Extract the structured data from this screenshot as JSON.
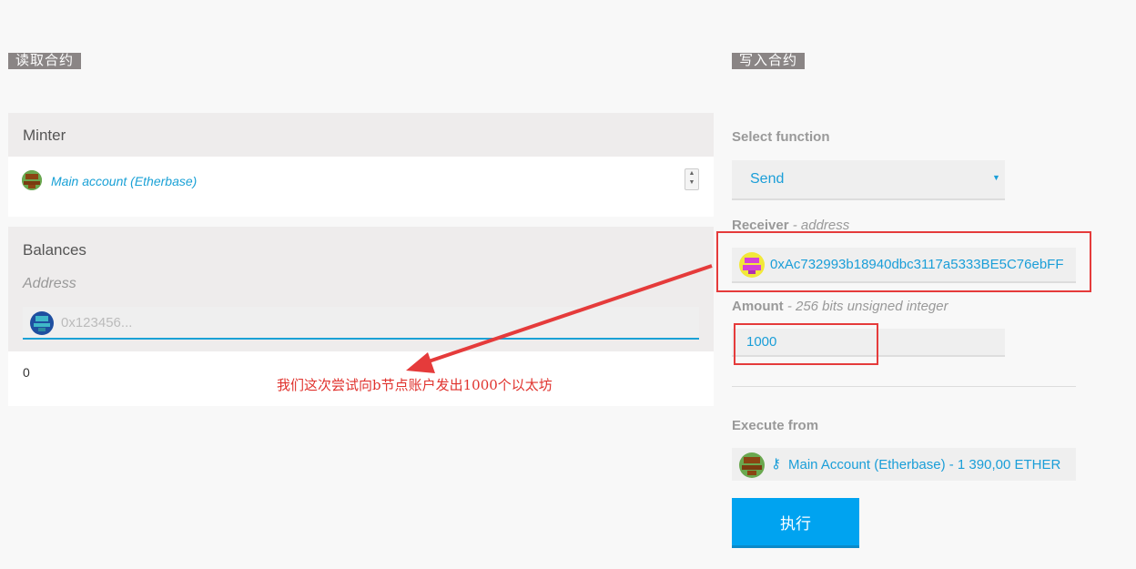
{
  "read_section": {
    "tag": "读取合约",
    "minter": {
      "title": "Minter",
      "account_name": "Main account (Etherbase)"
    },
    "balances": {
      "title": "Balances",
      "address_label": "Address",
      "address_placeholder": "0x123456...",
      "result": "0"
    }
  },
  "write_section": {
    "tag": "写入合约",
    "select_function": {
      "label": "Select function",
      "selected": "Send"
    },
    "receiver": {
      "label": "Receiver",
      "hint": "- address",
      "value": "0xAc732993b18940dbc3117a5333BE5C76ebFF"
    },
    "amount": {
      "label": "Amount",
      "hint": "- 256 bits unsigned integer",
      "value": "1000"
    },
    "execute_from": {
      "label": "Execute from",
      "account": "Main Account (Etherbase) - 1 390,00 ETHER"
    },
    "execute_button": "执行"
  },
  "annotation": {
    "text": "我们这次尝试向b节点账户发出1000个以太坊"
  },
  "colors": {
    "accent": "#00a3f0",
    "link": "#1aa1d6",
    "annotation_red": "#e53b3b"
  }
}
